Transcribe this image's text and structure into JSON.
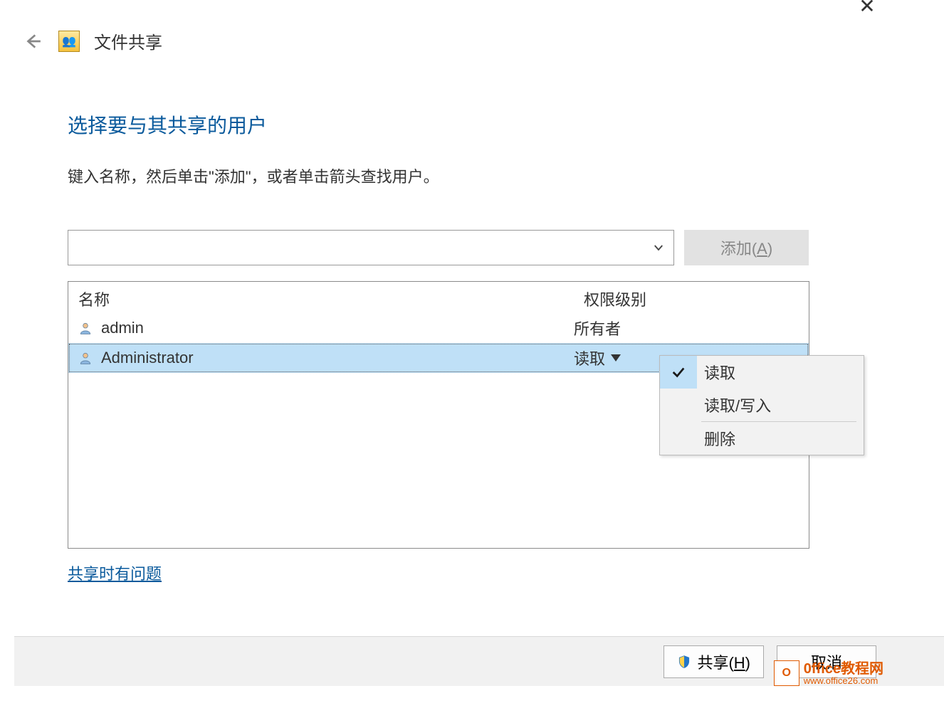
{
  "header": {
    "title": "文件共享"
  },
  "heading": "选择要与其共享的用户",
  "subtext": "键入名称，然后单击\"添加\"，或者单击箭头查找用户。",
  "input": {
    "value": ""
  },
  "add_button": {
    "prefix": "添加(",
    "hotkey": "A",
    "suffix": ")"
  },
  "columns": {
    "name": "名称",
    "permission": "权限级别"
  },
  "rows": [
    {
      "name": "admin",
      "permission": "所有者",
      "selected": false,
      "has_dropdown": false
    },
    {
      "name": "Administrator",
      "permission": "读取",
      "selected": true,
      "has_dropdown": true
    }
  ],
  "help_link": "共享时有问题",
  "menu": {
    "items": [
      {
        "label": "读取",
        "checked": true
      },
      {
        "label": "读取/写入",
        "checked": false
      }
    ],
    "remove": "删除"
  },
  "footer": {
    "share_prefix": "共享(",
    "share_hotkey": "H",
    "share_suffix": ")",
    "cancel": "取消"
  },
  "watermark": {
    "badge": "O",
    "line1": "0ffice教程网",
    "line2": "www.office26.com"
  },
  "close_glyph": "✕"
}
